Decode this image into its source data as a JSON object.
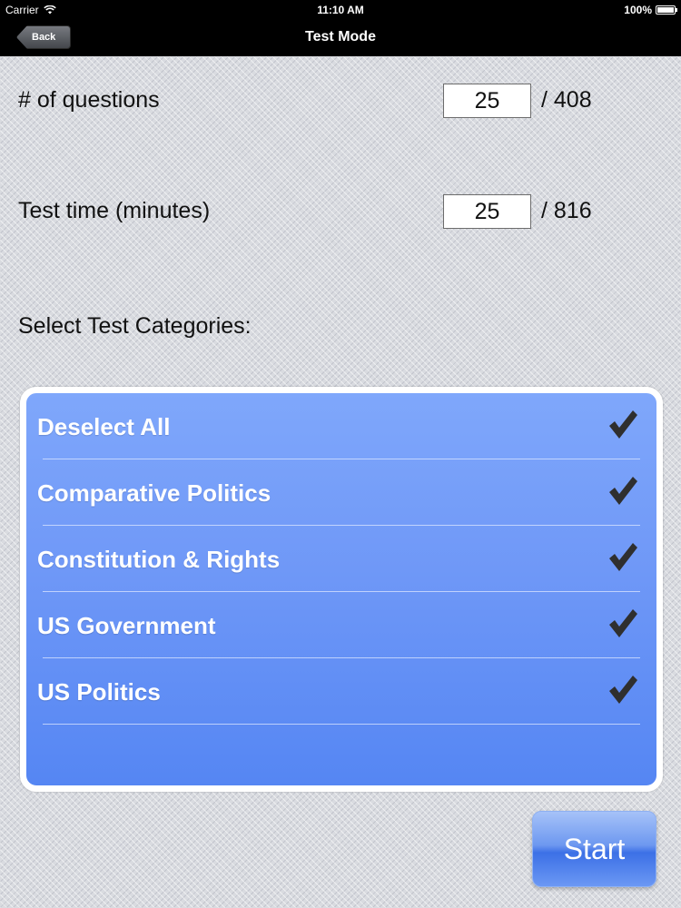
{
  "status_bar": {
    "carrier": "Carrier",
    "time": "11:10 AM",
    "battery": "100%",
    "icons": [
      "wifi-icon",
      "battery-icon"
    ]
  },
  "nav": {
    "back_label": "Back",
    "title": "Test Mode"
  },
  "settings": {
    "questions": {
      "label": "# of questions",
      "value": "25",
      "total": "/ 408"
    },
    "time": {
      "label": "Test time (minutes)",
      "value": "25",
      "total": "/ 816"
    }
  },
  "categories": {
    "heading": "Select Test Categories:",
    "items": [
      {
        "label": "Deselect All",
        "checked": true
      },
      {
        "label": "Comparative Politics",
        "checked": true
      },
      {
        "label": "Constitution & Rights",
        "checked": true
      },
      {
        "label": "US Government",
        "checked": true
      },
      {
        "label": "US Politics",
        "checked": true
      }
    ]
  },
  "actions": {
    "start_label": "Start"
  },
  "colors": {
    "panel_top": "#7fa7fb",
    "panel_bottom": "#5586f3",
    "check": "#2f2f2f",
    "nav_bg": "#000000"
  }
}
